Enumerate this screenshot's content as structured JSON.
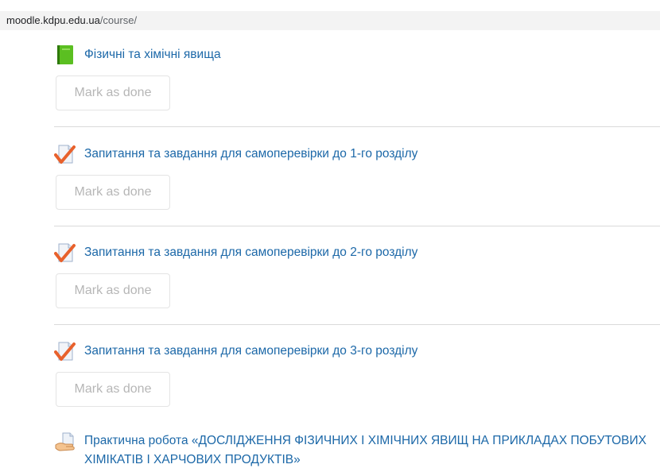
{
  "browser": {
    "url_domain": "moodle.kdpu.edu.ua",
    "url_path": "/course/"
  },
  "activities": [
    {
      "icon": "book-icon",
      "title": "Фізичні та хімічні явища",
      "button": "Mark as done"
    },
    {
      "icon": "quiz-check-icon",
      "title": "Запитання та завдання для самоперевірки до 1-го розділу",
      "button": "Mark as done"
    },
    {
      "icon": "quiz-check-icon",
      "title": "Запитання та завдання для самоперевірки до 2-го розділу",
      "button": "Mark as done"
    },
    {
      "icon": "quiz-check-icon",
      "title": "Запитання та завдання для самоперевірки до 3-го розділу",
      "button": "Mark as done"
    },
    {
      "icon": "assignment-hand-icon",
      "title": "Практична робота «ДОСЛІДЖЕННЯ ФІЗИЧНИХ І ХІМІЧНИХ ЯВИЩ НА ПРИКЛАДАХ ПОБУТОВИХ ХІМІКАТІВ І ХАРЧОВИХ ПРОДУКТІВ»"
    }
  ],
  "colors": {
    "link": "#1c68a8",
    "button_text": "#b6b6b6",
    "separator": "#dadada",
    "check": "#e8612c",
    "book": "#5bbf21"
  }
}
